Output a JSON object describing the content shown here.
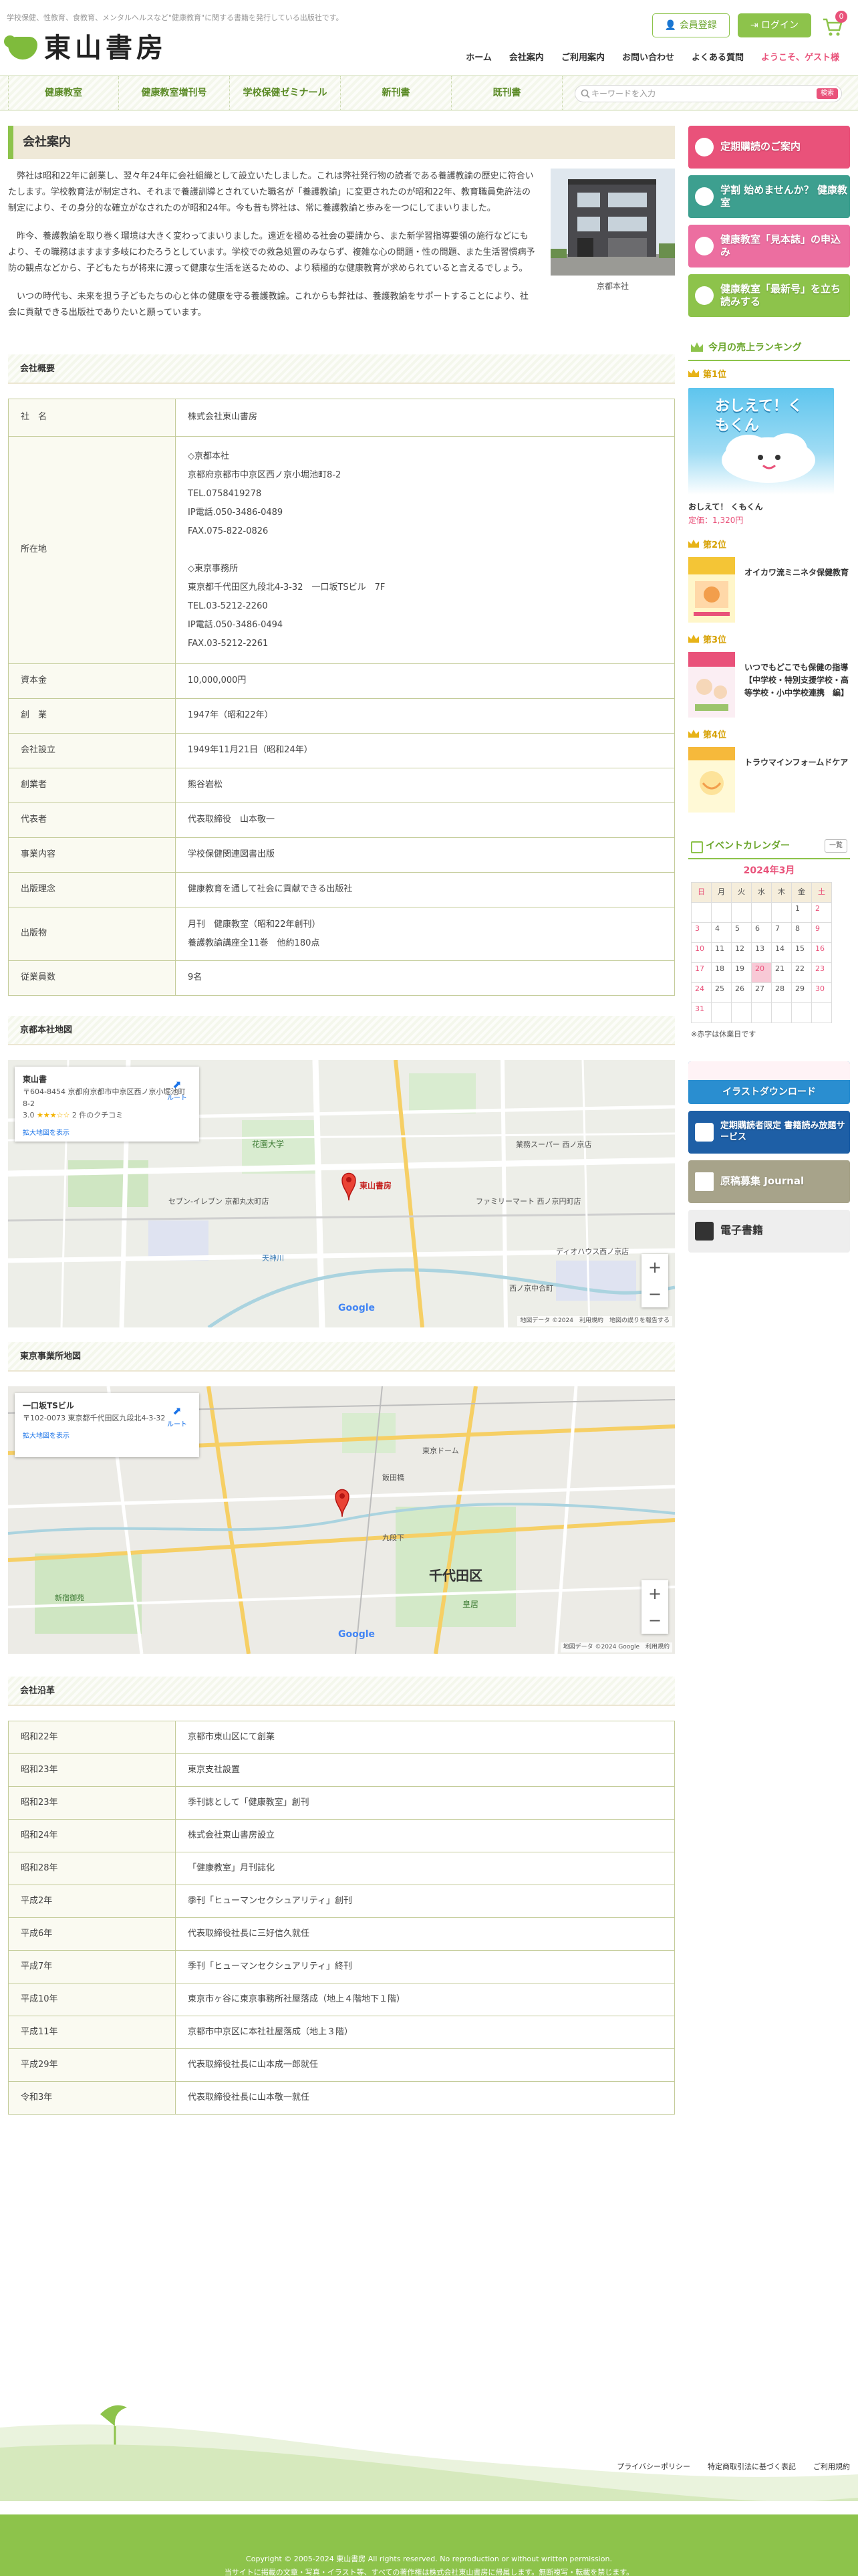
{
  "header": {
    "tagline": "学校保健、性教育、食教育、メンタルヘルスなど\"健康教育\"に関する書籍を発行している出版社です。",
    "logo_text": "東山書房",
    "register_label": "会員登録",
    "login_label": "ログイン",
    "cart_count": "0",
    "nav": [
      "ホーム",
      "会社案内",
      "ご利用案内",
      "お問い合わせ",
      "よくある質問"
    ],
    "welcome": "ようこそ、ゲスト様"
  },
  "category_nav": [
    "健康教室",
    "健康教室増刊号",
    "学校保健ゼミナール",
    "新刊書",
    "既刊書"
  ],
  "search": {
    "placeholder": "キーワードを入力",
    "button_label": "検索"
  },
  "main": {
    "page_title": "会社案内",
    "intro_paragraphs": [
      "弊社は昭和22年に創業し、翌々年24年に会社組織として設立いたしました。これは弊社発行物の読者である養護教諭の歴史に符合いたします。学校教育法が制定され、それまで養護訓導とされていた職名が「養護教諭」に変更されたのが昭和22年、教育職員免許法の制定により、その身分的な確立がなされたのが昭和24年。今も昔も弊社は、常に養護教諭と歩みを一つにしてまいりました。",
      "昨今、養護教諭を取り巻く環境は大きく変わってまいりました。遠近を極める社会の要請から、また新学習指導要領の施行などにもより、その職務はますます多岐にわたろうとしています。学校での救急処置のみならず、複雑な心の問題・性の問題、また生活習慣病予防の観点などから、子どもたちが将来に渡って健康な生活を送るための、より積極的な健康教育が求められていると言えるでしょう。",
      "いつの時代も、未来を担う子どもたちの心と体の健康を守る養護教諭。これからも弊社は、養護教諭をサポートすることにより、社会に貢献できる出版社でありたいと願っています。"
    ],
    "building_caption": "京都本社",
    "overview_title": "会社概要",
    "overview": [
      {
        "k": "社　名",
        "v": [
          "株式会社東山書房"
        ]
      },
      {
        "k": "所在地",
        "v": [
          "◇京都本社",
          "京都府京都市中京区西ノ京小堀池町8-2",
          "TEL.0758419278",
          "IP電話.050-3486-0489",
          "FAX.075-822-0826",
          "",
          "◇東京事務所",
          "東京都千代田区九段北4-3-32　一口坂TSビル　7F",
          "TEL.03-5212-2260",
          "IP電話.050-3486-0494",
          "FAX.03-5212-2261"
        ]
      },
      {
        "k": "資本金",
        "v": [
          "10,000,000円"
        ]
      },
      {
        "k": "創　業",
        "v": [
          "1947年（昭和22年）"
        ]
      },
      {
        "k": "会社設立",
        "v": [
          "1949年11月21日（昭和24年）"
        ]
      },
      {
        "k": "創業者",
        "v": [
          "熊谷岩松"
        ]
      },
      {
        "k": "代表者",
        "v": [
          "代表取締役　山本敬一"
        ]
      },
      {
        "k": "事業内容",
        "v": [
          "学校保健関連図書出版"
        ]
      },
      {
        "k": "出版理念",
        "v": [
          "健康教育を通して社会に貢献できる出版社"
        ]
      },
      {
        "k": "出版物",
        "v": [
          "月刊　健康教室（昭和22年創刊）",
          "養護教諭講座全11巻　他約180点"
        ]
      },
      {
        "k": "従業員数",
        "v": [
          "9名"
        ]
      }
    ],
    "kyoto_map": {
      "title": "京都本社地図",
      "card_name": "東山書",
      "card_addr": "〒604-8454 京都府京都市中京区西ノ京小堀池町8-2",
      "card_rating": "3.0",
      "card_stars": "★★★☆☆",
      "card_reviews": "2 件のクチコミ",
      "card_link": "拡大地図を表示",
      "card_dir": "ルート",
      "pin_label": "東山書房",
      "labels": [
        "花園大学",
        "セブン-イレブン 京都丸太町店",
        "業務スーパー 西ノ京店",
        "ファミリーマート 西ノ京円町店",
        "天神川",
        "西ノ京中合町",
        "ディオハウス西ノ京店"
      ],
      "footer": "地図データ ©2024　利用規約　地図の誤りを報告する"
    },
    "tokyo_map": {
      "title": "東京事業所地図",
      "card_name": "一口坂TSビル",
      "card_addr": "〒102-0073 東京都千代田区九段北4-3-32",
      "card_link": "拡大地図を表示",
      "card_dir": "ルート",
      "labels": [
        "千代田区",
        "東京ドーム",
        "飯田橋",
        "九段下",
        "皇居",
        "新宿御苑"
      ],
      "footer": "地図データ ©2024 Google　利用規約"
    },
    "history_title": "会社沿革",
    "history": [
      {
        "k": "昭和22年",
        "v": "京都市東山区にて創業"
      },
      {
        "k": "昭和23年",
        "v": "東京支社設置"
      },
      {
        "k": "昭和23年",
        "v": "季刊誌として「健康教室」創刊"
      },
      {
        "k": "昭和24年",
        "v": "株式会社東山書房設立"
      },
      {
        "k": "昭和28年",
        "v": "「健康教室」月刊誌化"
      },
      {
        "k": "平成2年",
        "v": "季刊「ヒューマンセクシュアリティ」創刊"
      },
      {
        "k": "平成6年",
        "v": "代表取締役社長に三好信久就任"
      },
      {
        "k": "平成7年",
        "v": "季刊「ヒューマンセクシュアリティ」終刊"
      },
      {
        "k": "平成10年",
        "v": "東京市ヶ谷に東京事務所社屋落成（地上４階地下１階）"
      },
      {
        "k": "平成11年",
        "v": "京都市中京区に本社社屋落成（地上３階）"
      },
      {
        "k": "平成29年",
        "v": "代表取締役社長に山本成一郎就任"
      },
      {
        "k": "令和3年",
        "v": "代表取締役社長に山本敬一就任"
      }
    ]
  },
  "sidebar": {
    "banners": [
      {
        "text": "定期購読のご案内",
        "color": "#e9527a"
      },
      {
        "text": "学割 始めませんか？ 健康教室",
        "color": "#3d9f8f"
      },
      {
        "text": "健康教室「見本誌」の申込み",
        "color": "#ec6ea0"
      },
      {
        "text": "健康教室「最新号」を立ち読みする",
        "color": "#8dc34b"
      }
    ],
    "ranking_title": "今月の売上ランキング",
    "rank1_label": "第1位",
    "rank1_cover_text": "おしえて！くもくん",
    "rank1_name": "おしえて！ くもくん",
    "rank1_price": "定価：1,320円",
    "ranks": [
      {
        "label": "第2位",
        "name": "オイカワ流ミニネタ保健教育"
      },
      {
        "label": "第3位",
        "name": "いつでもどこでも保健の指導　【中学校・特別支援学校・高等学校・小中学校連携　編】"
      },
      {
        "label": "第4位",
        "name": "トラウマインフォームドケア"
      }
    ],
    "calendar": {
      "title": "イベントカレンダー",
      "list_label": "一覧",
      "month": "2024年3月",
      "weekdays": [
        "日",
        "月",
        "火",
        "水",
        "木",
        "金",
        "土"
      ],
      "days": [
        "",
        "",
        "",
        "",
        "",
        "1",
        "2",
        "3",
        "4",
        "5",
        "6",
        "7",
        "8",
        "9",
        "10",
        "11",
        "12",
        "13",
        "14",
        "15",
        "16",
        "17",
        "18",
        "19",
        "20",
        "21",
        "22",
        "23",
        "24",
        "25",
        "26",
        "27",
        "28",
        "29",
        "30",
        "31",
        "",
        "",
        "",
        "",
        "",
        ""
      ],
      "holidays": [
        "20"
      ],
      "note": "※赤字は休業日です"
    },
    "banners2": [
      {
        "text": "イラストダウンロード",
        "color": "#2a8ed0",
        "tcolor": "#ffffff"
      },
      {
        "text": "定期購読者限定 書籍読み放題サービス",
        "color": "#1e5fa6",
        "tcolor": "#ffffff"
      },
      {
        "text": "原稿募集 Journal",
        "color": "#a7a38a",
        "tcolor": "#ffffff"
      },
      {
        "text": "電子書籍",
        "color": "#eeeeee",
        "tcolor": "#333333"
      }
    ]
  },
  "footer": {
    "links": [
      "プライバシーポリシー",
      "特定商取引法に基づく表記",
      "ご利用規約"
    ],
    "copyright": "Copyright © 2005-2024 東山書房 All rights reserved. No reproduction or without written permission.",
    "notice": "当サイトに掲載の文章・写真・イラスト等、すべての著作権は株式会社東山書房に帰属します。無断複写・転載を禁じます。"
  }
}
